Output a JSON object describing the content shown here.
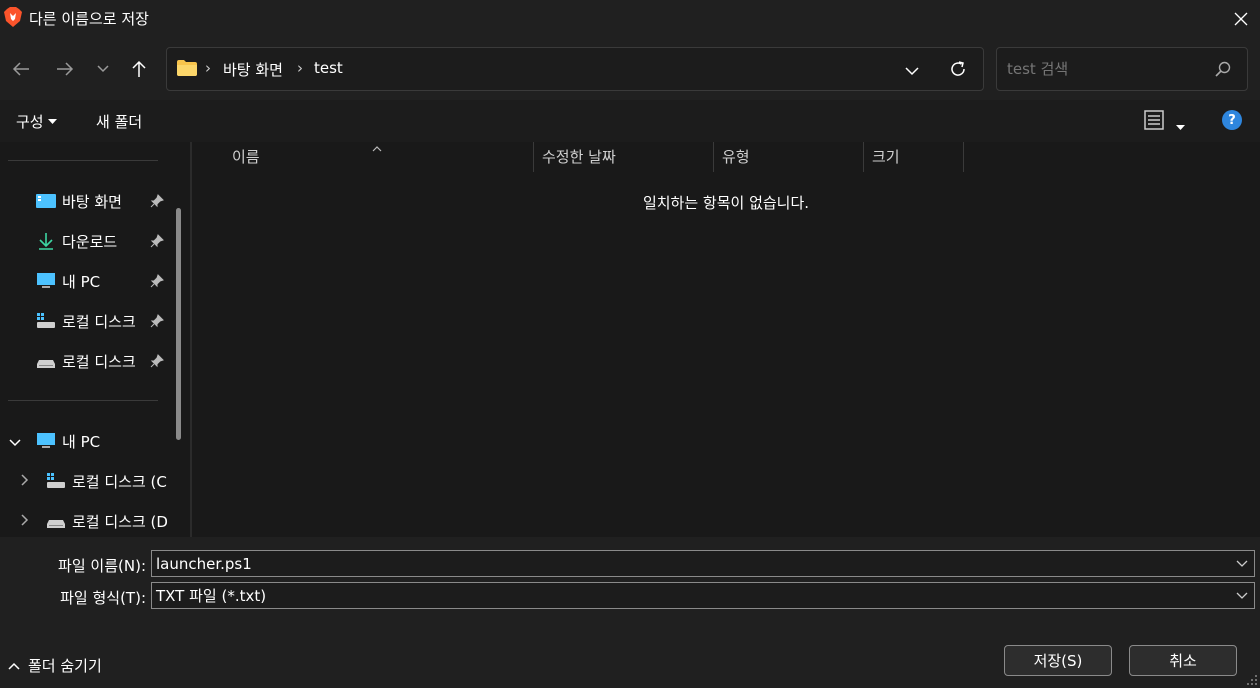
{
  "window": {
    "title": "다른 이름으로 저장"
  },
  "address": {
    "crumbs": [
      "바탕 화면",
      "test"
    ]
  },
  "search": {
    "placeholder": "test 검색"
  },
  "toolbar": {
    "organize": "구성",
    "new_folder": "새 폴더"
  },
  "sidebar": {
    "quick": [
      {
        "label": "바탕 화면",
        "icon": "desktop-icon"
      },
      {
        "label": "다운로드",
        "icon": "download-icon"
      },
      {
        "label": "내 PC",
        "icon": "pc-icon"
      },
      {
        "label": "로컬 디스크",
        "icon": "drive-c-icon"
      },
      {
        "label": "로컬 디스크",
        "icon": "drive-icon"
      }
    ],
    "tree": [
      {
        "label": "내 PC"
      },
      {
        "label": "로컬 디스크 (C"
      },
      {
        "label": "로컬 디스크 (D"
      }
    ]
  },
  "columns": [
    "이름",
    "수정한 날짜",
    "유형",
    "크기"
  ],
  "empty_message": "일치하는 항목이 없습니다.",
  "form": {
    "filename_label": "파일 이름(N):",
    "filename_value": "launcher.ps1",
    "filetype_label": "파일 형식(T):",
    "filetype_value": "TXT 파일 (*.txt)"
  },
  "footer": {
    "hide_folders": "폴더 숨기기",
    "save": "저장(S)",
    "cancel": "취소"
  },
  "colors": {
    "accent": "#0078d4",
    "folder": "#f8c44c",
    "help": "#2e86de"
  }
}
